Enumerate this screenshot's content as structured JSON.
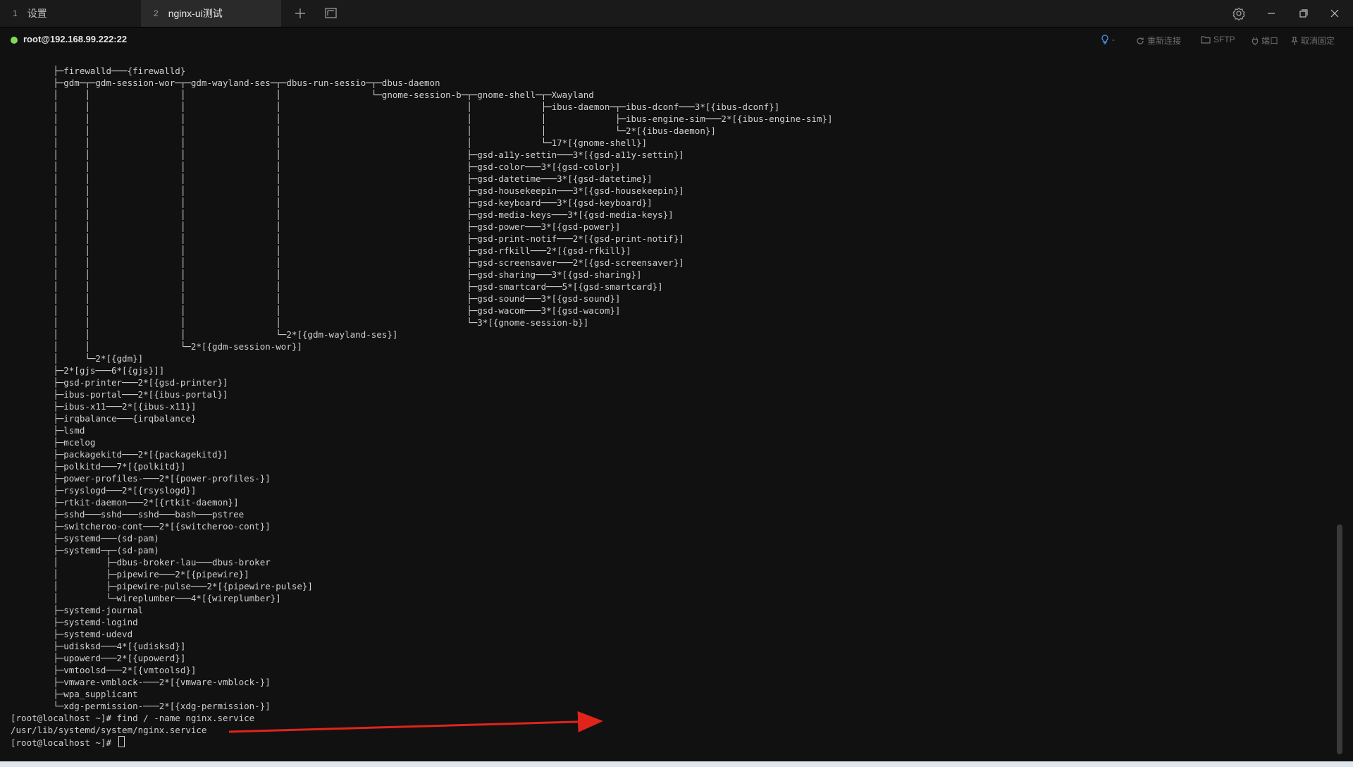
{
  "tabs": [
    {
      "number": "1",
      "title": "设置"
    },
    {
      "number": "2",
      "title": "nginx-ui测试"
    }
  ],
  "icons": {
    "add_tab": "plus-icon",
    "duplicate_tab": "window-duplicate-icon",
    "settings": "gear-icon",
    "minimize": "minimize-icon",
    "maximize": "restore-icon",
    "close": "close-icon",
    "hint": "lightbulb-icon",
    "reconnect": "refresh-icon",
    "sftp": "folder-icon",
    "port": "plug-icon",
    "unpin": "pin-icon"
  },
  "session": {
    "host": "root@192.168.99.222:22",
    "status_color": "#7ed957",
    "hint_suffix": "-",
    "reconnect_label": "重新连接",
    "sftp_label": "SFTP",
    "port_label": "端口",
    "unpin_label": "取消固定"
  },
  "terminal": {
    "lines": [
      "        ├─firewalld───{firewalld}",
      "        ├─gdm─┬─gdm-session-wor─┬─gdm-wayland-ses─┬─dbus-run-sessio─┬─dbus-daemon",
      "        │     │                 │                 │                 └─gnome-session-b─┬─gnome-shell─┬─Xwayland",
      "        │     │                 │                 │                                   │             ├─ibus-daemon─┬─ibus-dconf───3*[{ibus-dconf}]",
      "        │     │                 │                 │                                   │             │             ├─ibus-engine-sim───2*[{ibus-engine-sim}]",
      "        │     │                 │                 │                                   │             │             └─2*[{ibus-daemon}]",
      "        │     │                 │                 │                                   │             └─17*[{gnome-shell}]",
      "        │     │                 │                 │                                   ├─gsd-a11y-settin───3*[{gsd-a11y-settin}]",
      "        │     │                 │                 │                                   ├─gsd-color───3*[{gsd-color}]",
      "        │     │                 │                 │                                   ├─gsd-datetime───3*[{gsd-datetime}]",
      "        │     │                 │                 │                                   ├─gsd-housekeepin───3*[{gsd-housekeepin}]",
      "        │     │                 │                 │                                   ├─gsd-keyboard───3*[{gsd-keyboard}]",
      "        │     │                 │                 │                                   ├─gsd-media-keys───3*[{gsd-media-keys}]",
      "        │     │                 │                 │                                   ├─gsd-power───3*[{gsd-power}]",
      "        │     │                 │                 │                                   ├─gsd-print-notif───2*[{gsd-print-notif}]",
      "        │     │                 │                 │                                   ├─gsd-rfkill───2*[{gsd-rfkill}]",
      "        │     │                 │                 │                                   ├─gsd-screensaver───2*[{gsd-screensaver}]",
      "        │     │                 │                 │                                   ├─gsd-sharing───3*[{gsd-sharing}]",
      "        │     │                 │                 │                                   ├─gsd-smartcard───5*[{gsd-smartcard}]",
      "        │     │                 │                 │                                   ├─gsd-sound───3*[{gsd-sound}]",
      "        │     │                 │                 │                                   ├─gsd-wacom───3*[{gsd-wacom}]",
      "        │     │                 │                 │                                   └─3*[{gnome-session-b}]",
      "        │     │                 │                 └─2*[{gdm-wayland-ses}]",
      "        │     │                 └─2*[{gdm-session-wor}]",
      "        │     └─2*[{gdm}]",
      "        ├─2*[gjs───6*[{gjs}]]",
      "        ├─gsd-printer───2*[{gsd-printer}]",
      "        ├─ibus-portal───2*[{ibus-portal}]",
      "        ├─ibus-x11───2*[{ibus-x11}]",
      "        ├─irqbalance───{irqbalance}",
      "        ├─lsmd",
      "        ├─mcelog",
      "        ├─packagekitd───2*[{packagekitd}]",
      "        ├─polkitd───7*[{polkitd}]",
      "        ├─power-profiles-───2*[{power-profiles-}]",
      "        ├─rsyslogd───2*[{rsyslogd}]",
      "        ├─rtkit-daemon───2*[{rtkit-daemon}]",
      "        ├─sshd───sshd───sshd───bash───pstree",
      "        ├─switcheroo-cont───2*[{switcheroo-cont}]",
      "        ├─systemd───(sd-pam)",
      "        ├─systemd─┬─(sd-pam)",
      "        │         ├─dbus-broker-lau───dbus-broker",
      "        │         ├─pipewire───2*[{pipewire}]",
      "        │         ├─pipewire-pulse───2*[{pipewire-pulse}]",
      "        │         └─wireplumber───4*[{wireplumber}]",
      "        ├─systemd-journal",
      "        ├─systemd-logind",
      "        ├─systemd-udevd",
      "        ├─udisksd───4*[{udisksd}]",
      "        ├─upowerd───2*[{upowerd}]",
      "        ├─vmtoolsd───2*[{vmtoolsd}]",
      "        ├─vmware-vmblock-───2*[{vmware-vmblock-}]",
      "        ├─wpa_supplicant",
      "        └─xdg-permission-───2*[{xdg-permission-}]",
      "[root@localhost ~]# find / -name nginx.service",
      "/usr/lib/systemd/system/nginx.service",
      "[root@localhost ~]# "
    ],
    "annotation_arrow_color": "#e0241b"
  }
}
